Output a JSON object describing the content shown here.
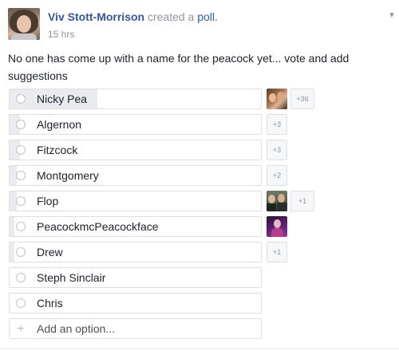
{
  "post": {
    "author": "Viv Stott-Morrison",
    "action": "created a",
    "object": "poll.",
    "time": "15 hrs",
    "question": "No one has come up with a name for the peacock yet... vote and add suggestions"
  },
  "poll": {
    "options": [
      {
        "label": "Nicky Pea",
        "extra_votes": "+36",
        "fill_fraction": 0.35
      },
      {
        "label": "Algernon",
        "extra_votes": "+3",
        "fill_fraction": 0.04
      },
      {
        "label": "Fitzcock",
        "extra_votes": "+3",
        "fill_fraction": 0.04
      },
      {
        "label": "Montgomery",
        "extra_votes": "+2",
        "fill_fraction": 0.03
      },
      {
        "label": "Flop",
        "extra_votes": "+1",
        "fill_fraction": 0.03
      },
      {
        "label": "PeacockmcPeacockface",
        "extra_votes": "",
        "fill_fraction": 0.02
      },
      {
        "label": "Drew",
        "extra_votes": "+1",
        "fill_fraction": 0.02
      },
      {
        "label": "Steph Sinclair",
        "extra_votes": "",
        "fill_fraction": 0
      },
      {
        "label": "Chris",
        "extra_votes": "",
        "fill_fraction": 0
      }
    ],
    "add_option_placeholder": "Add an option..."
  },
  "icons": {
    "radio": "radio-button-icon",
    "add": "plus-icon",
    "menu": "chevron-down-icon"
  },
  "colors": {
    "link": "#365899",
    "meta": "#90949c",
    "border": "#dddfe2",
    "fill": "#e9ebee"
  }
}
